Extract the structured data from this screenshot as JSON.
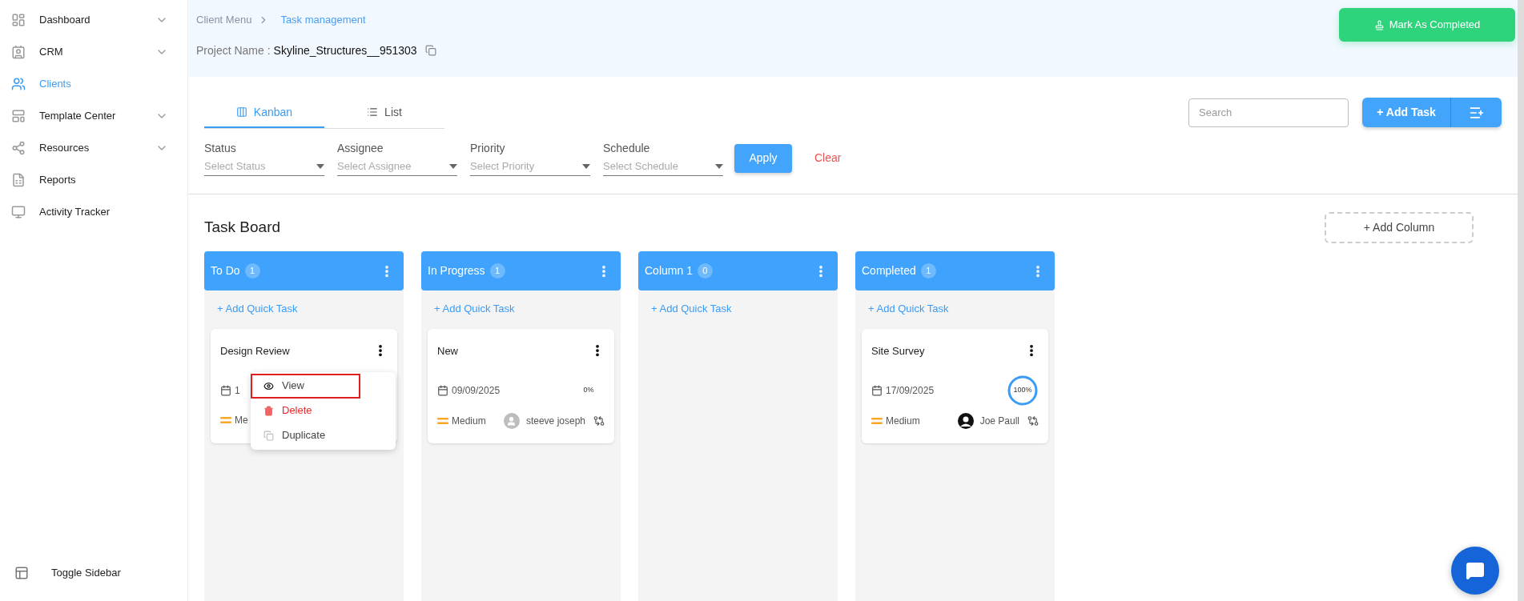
{
  "sidebar": {
    "items": [
      {
        "label": "Dashboard",
        "selected": false,
        "expandable": true
      },
      {
        "label": "CRM",
        "selected": false,
        "expandable": true
      },
      {
        "label": "Clients",
        "selected": true,
        "expandable": false
      },
      {
        "label": "Template Center",
        "selected": false,
        "expandable": true
      },
      {
        "label": "Resources",
        "selected": false,
        "expandable": true
      },
      {
        "label": "Reports",
        "selected": false,
        "expandable": false
      },
      {
        "label": "Activity Tracker",
        "selected": false,
        "expandable": false
      }
    ],
    "toggle": "Toggle Sidebar"
  },
  "breadcrumb": [
    "Client Menu",
    "Task management"
  ],
  "project": {
    "label": "Project Name :",
    "value": "Skyline_Structures__951303"
  },
  "mark_completed": "Mark As Completed",
  "tabs": [
    {
      "label": "Kanban",
      "selected": true
    },
    {
      "label": "List",
      "selected": false
    }
  ],
  "search": {
    "placeholder": "Search"
  },
  "add_task": "+ Add Task",
  "filters": [
    {
      "label": "Status",
      "placeholder": "Select Status"
    },
    {
      "label": "Assignee",
      "placeholder": "Select Assignee"
    },
    {
      "label": "Priority",
      "placeholder": "Select Priority"
    },
    {
      "label": "Schedule",
      "placeholder": "Select Schedule"
    }
  ],
  "apply": "Apply",
  "clear": "Clear",
  "board": {
    "title": "Task Board",
    "add_column": "+ Add Column",
    "columns": [
      {
        "title": "To Do",
        "count": "1",
        "add": "+ Add Quick Task",
        "cards": [
          {
            "title": "Design Review",
            "date": "1",
            "priority": "Me",
            "menu": [
              {
                "label": "View",
                "kind": "view",
                "highlighted": true
              },
              {
                "label": "Delete",
                "kind": "delete",
                "highlighted": false
              },
              {
                "label": "Duplicate",
                "kind": "duplicate",
                "highlighted": false
              }
            ]
          }
        ]
      },
      {
        "title": "In Progress",
        "count": "1",
        "add": "+ Add Quick Task",
        "cards": [
          {
            "title": "New",
            "date": "09/09/2025",
            "progress": "0%",
            "priority": "Medium",
            "assignee": {
              "name": "steeve joseph",
              "kind": "generic"
            }
          }
        ]
      },
      {
        "title": "Column 1",
        "count": "0",
        "add": "+ Add Quick Task"
      },
      {
        "title": "Completed",
        "count": "1",
        "add": "+ Add Quick Task",
        "cards": [
          {
            "title": "Site Survey",
            "date": "17/09/2025",
            "progress": "100%",
            "level": 1,
            "priority": "Medium",
            "assignee": {
              "name": "Joe Paull",
              "kind": "photo"
            }
          }
        ]
      }
    ]
  }
}
